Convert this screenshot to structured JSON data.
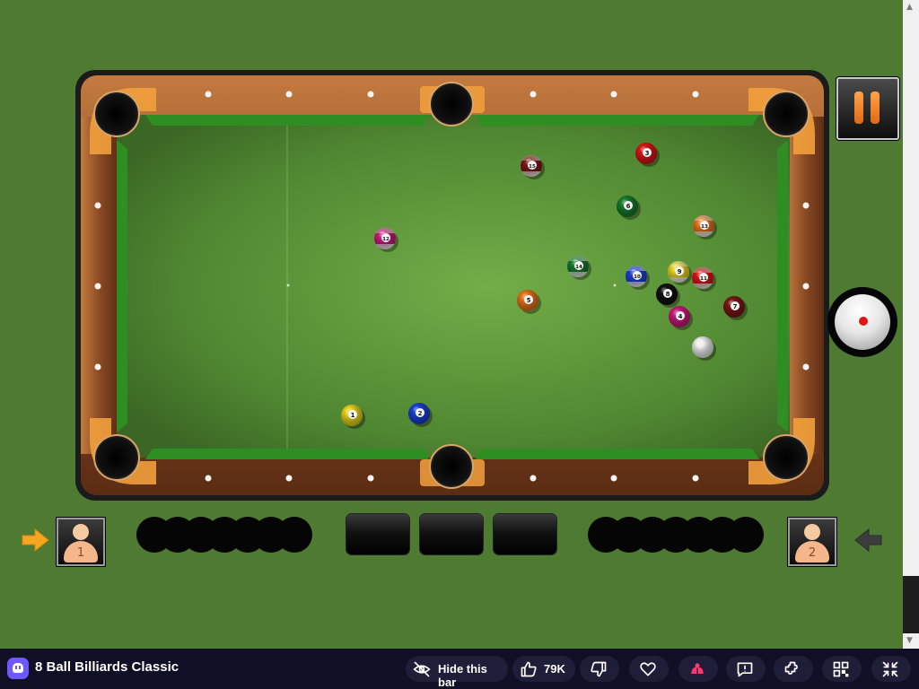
{
  "game": {
    "title": "8 Ball Billiards Classic",
    "table": {
      "felt_color": "#5f9c3a",
      "rail_color": "#8b4a24",
      "cushion_color": "#2e8e22",
      "pockets": [
        "top-left",
        "top-middle",
        "top-right",
        "bottom-left",
        "bottom-middle",
        "bottom-right"
      ]
    },
    "balls": [
      {
        "id": "cue",
        "color": "#eeeeee",
        "stripe": false,
        "number": ""
      },
      {
        "id": "1",
        "color": "#e8d21d",
        "stripe": false,
        "number": "1"
      },
      {
        "id": "2",
        "color": "#1b3fd1",
        "stripe": false,
        "number": "2"
      },
      {
        "id": "3",
        "color": "#d81515",
        "stripe": false,
        "number": "3"
      },
      {
        "id": "4",
        "color": "#c8197a",
        "stripe": false,
        "number": "4"
      },
      {
        "id": "5",
        "color": "#e3731b",
        "stripe": false,
        "number": "5"
      },
      {
        "id": "6",
        "color": "#167a2c",
        "stripe": false,
        "number": "6"
      },
      {
        "id": "7",
        "color": "#7a1717",
        "stripe": false,
        "number": "7"
      },
      {
        "id": "8",
        "color": "#111111",
        "stripe": false,
        "number": "8"
      },
      {
        "id": "9",
        "color": "#e8d21d",
        "stripe": true,
        "number": "9"
      },
      {
        "id": "10",
        "color": "#1b3fd1",
        "stripe": true,
        "number": "10"
      },
      {
        "id": "11",
        "color": "#d81515",
        "stripe": true,
        "number": "11"
      },
      {
        "id": "12",
        "color": "#c8197a",
        "stripe": true,
        "number": "12"
      },
      {
        "id": "13",
        "color": "#e3731b",
        "stripe": true,
        "number": "13"
      },
      {
        "id": "14",
        "color": "#167a2c",
        "stripe": true,
        "number": "14"
      },
      {
        "id": "15",
        "color": "#7a1717",
        "stripe": true,
        "number": "15"
      }
    ],
    "players": [
      {
        "label": "1",
        "active": true
      },
      {
        "label": "2",
        "active": false
      }
    ],
    "pocketed_slots": {
      "player1": 7,
      "player2": 7
    },
    "shot_boxes": 3,
    "colors": {
      "accent_orange": "#f5a623",
      "inactive_arrow": "#3d3d3d",
      "background": "#4f7a31"
    }
  },
  "controls": {
    "pause": "pause-icon",
    "cue_ball_spin": "cue-ball-spin-icon"
  },
  "bottom_bar": {
    "title": "8 Ball Billiards Classic",
    "hide_label": "Hide this bar",
    "likes": "79K",
    "colors": {
      "background": "#0f0f26",
      "button": "#1e1e38",
      "logo": "#6d59ff",
      "bug": "#ff3b6b"
    }
  }
}
